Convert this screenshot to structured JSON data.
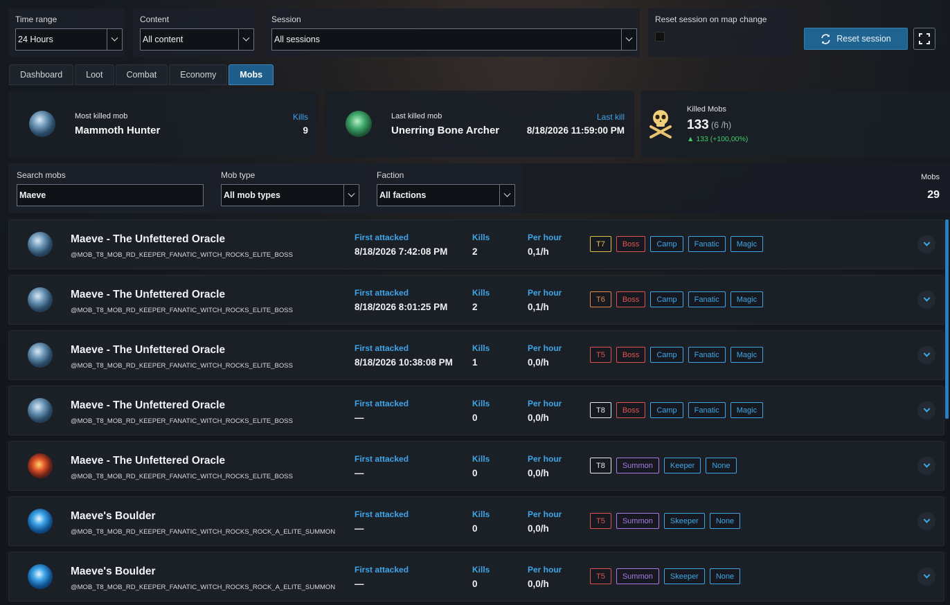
{
  "filters": {
    "time_range": {
      "label": "Time range",
      "value": "24 Hours"
    },
    "content": {
      "label": "Content",
      "value": "All content"
    },
    "session": {
      "label": "Session",
      "value": "All sessions"
    },
    "reset_on_map": {
      "label": "Reset session on map change",
      "checked": false
    },
    "reset_button": "Reset session"
  },
  "tabs": [
    "Dashboard",
    "Loot",
    "Combat",
    "Economy",
    "Mobs"
  ],
  "active_tab": "Mobs",
  "stats": {
    "most_killed": {
      "label": "Most killed mob",
      "name": "Mammoth Hunter",
      "right_label": "Kills",
      "right_value": "9"
    },
    "last_killed": {
      "label": "Last killed mob",
      "name": "Unerring Bone Archer",
      "right_label": "Last kill",
      "right_value": "8/18/2026 11:59:00 PM"
    },
    "killed_mobs": {
      "label": "Killed Mobs",
      "count": "133",
      "rate": "(6 /h)",
      "delta": "133 (+100,00%)"
    }
  },
  "mob_filters": {
    "search": {
      "label": "Search mobs",
      "value": "Maeve"
    },
    "mob_type": {
      "label": "Mob type",
      "value": "All mob types"
    },
    "faction": {
      "label": "Faction",
      "value": "All factions"
    },
    "mobs_count": {
      "label": "Mobs",
      "value": "29"
    }
  },
  "columns": {
    "first_attacked": "First attacked",
    "kills": "Kills",
    "per_hour": "Per hour"
  },
  "tag_colors": {
    "T5": "#e05252",
    "T6": "#e0884a",
    "T7": "#e0c24a",
    "T8": "#e6e9ee",
    "Boss": "#e05252",
    "Summon": "#a77be8",
    "Camp": "#3ea6e8",
    "Fanatic": "#3ea6e8",
    "Magic": "#3ea6e8",
    "Keeper": "#3ea6e8",
    "Skeeper": "#3ea6e8",
    "None": "#3ea6e8"
  },
  "mobs": [
    {
      "name": "Maeve - The Unfettered Oracle",
      "id": "@MOB_T8_MOB_RD_KEEPER_FANATIC_WITCH_ROCKS_ELITE_BOSS",
      "first_attacked": "8/18/2026 7:42:08 PM",
      "kills": "2",
      "per_hour": "0,1/h",
      "tags": [
        "T7",
        "Boss",
        "Camp",
        "Fanatic",
        "Magic"
      ],
      "icon": "oracle-icon"
    },
    {
      "name": "Maeve - The Unfettered Oracle",
      "id": "@MOB_T8_MOB_RD_KEEPER_FANATIC_WITCH_ROCKS_ELITE_BOSS",
      "first_attacked": "8/18/2026 8:01:25 PM",
      "kills": "2",
      "per_hour": "0,1/h",
      "tags": [
        "T6",
        "Boss",
        "Camp",
        "Fanatic",
        "Magic"
      ],
      "icon": "oracle-icon"
    },
    {
      "name": "Maeve - The Unfettered Oracle",
      "id": "@MOB_T8_MOB_RD_KEEPER_FANATIC_WITCH_ROCKS_ELITE_BOSS",
      "first_attacked": "8/18/2026 10:38:08 PM",
      "kills": "1",
      "per_hour": "0,0/h",
      "tags": [
        "T5",
        "Boss",
        "Camp",
        "Fanatic",
        "Magic"
      ],
      "icon": "oracle-icon"
    },
    {
      "name": "Maeve - The Unfettered Oracle",
      "id": "@MOB_T8_MOB_RD_KEEPER_FANATIC_WITCH_ROCKS_ELITE_BOSS",
      "first_attacked": "—",
      "kills": "0",
      "per_hour": "0,0/h",
      "tags": [
        "T8",
        "Boss",
        "Camp",
        "Fanatic",
        "Magic"
      ],
      "icon": "oracle-icon"
    },
    {
      "name": "Maeve - The Unfettered Oracle",
      "id": "@MOB_T8_MOB_RD_KEEPER_FANATIC_WITCH_ROCKS_ELITE_BOSS",
      "first_attacked": "—",
      "kills": "0",
      "per_hour": "0,0/h",
      "tags": [
        "T8",
        "Summon",
        "Keeper",
        "None"
      ],
      "icon": "fire-oracle-icon"
    },
    {
      "name": "Maeve's Boulder",
      "id": "@MOB_T8_MOB_RD_KEEPER_FANATIC_WITCH_ROCKS_ROCK_A_ELITE_SUMMON",
      "first_attacked": "—",
      "kills": "0",
      "per_hour": "0,0/h",
      "tags": [
        "T5",
        "Summon",
        "Skeeper",
        "None"
      ],
      "icon": "boulder-icon"
    },
    {
      "name": "Maeve's Boulder",
      "id": "@MOB_T8_MOB_RD_KEEPER_FANATIC_WITCH_ROCKS_ROCK_A_ELITE_SUMMON",
      "first_attacked": "—",
      "kills": "0",
      "per_hour": "0,0/h",
      "tags": [
        "T5",
        "Summon",
        "Skeeper",
        "None"
      ],
      "icon": "boulder-icon"
    }
  ]
}
